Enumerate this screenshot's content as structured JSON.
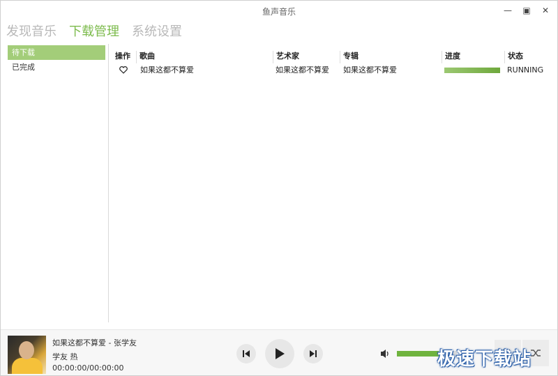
{
  "app": {
    "title": "鱼声音乐"
  },
  "window_controls": {
    "minimize": "—",
    "maximize": "▣",
    "close": "✕"
  },
  "nav": {
    "tabs": [
      {
        "label": "发现音乐",
        "active": false
      },
      {
        "label": "下载管理",
        "active": true
      },
      {
        "label": "系统设置",
        "active": false
      }
    ]
  },
  "sidebar": {
    "items": [
      {
        "label": "待下载",
        "active": true
      },
      {
        "label": "已完成",
        "active": false
      }
    ]
  },
  "table": {
    "headers": {
      "action": "操作",
      "song": "歌曲",
      "artist": "艺术家",
      "album": "专辑",
      "progress": "进度",
      "status": "状态"
    },
    "rows": [
      {
        "action_icon": "heart-icon",
        "song": "如果这都不算爱",
        "artist": "如果这都不算爱",
        "album": "如果这都不算爱",
        "progress": 1.0,
        "status": "RUNNING"
      }
    ]
  },
  "player": {
    "now_playing": "如果这都不算爱 - 张学友",
    "subtitle": "学友 热",
    "time": "00:00:00/00:00:00",
    "controls": [
      "previous-icon",
      "play-icon",
      "next-icon"
    ],
    "volume": 0.7
  },
  "watermark": {
    "text": "极速下载站"
  },
  "colors": {
    "accent": "#7dbb4d",
    "sidebar_active": "#a3cd79",
    "progress": "#6ea83c"
  }
}
